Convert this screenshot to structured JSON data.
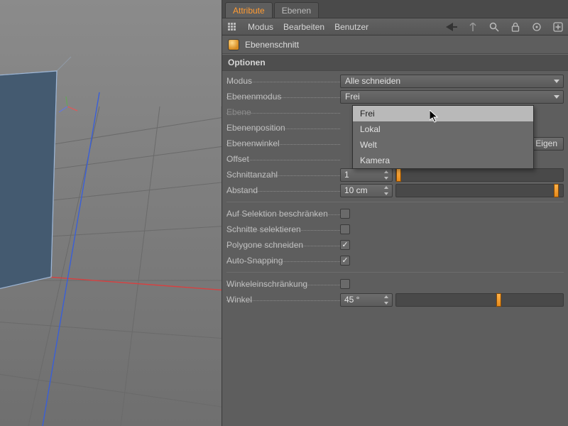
{
  "tabs": {
    "attribute": "Attribute",
    "ebenen": "Ebenen"
  },
  "menu": {
    "modus": "Modus",
    "bearbeiten": "Bearbeiten",
    "benutzer": "Benutzer"
  },
  "object": {
    "name": "Ebenenschnitt"
  },
  "section": {
    "optionen": "Optionen"
  },
  "params": {
    "modus": {
      "label": "Modus",
      "value": "Alle schneiden"
    },
    "ebenenmodus": {
      "label": "Ebenenmodus",
      "value": "Frei"
    },
    "ebene": {
      "label": "Ebene"
    },
    "ebenenposition": {
      "label": "Ebenenposition"
    },
    "ebenenwinkel": {
      "label": "Ebenenwinkel",
      "button": "Eigen"
    },
    "offset": {
      "label": "Offset"
    },
    "schnittanzahl": {
      "label": "Schnittanzahl",
      "value": "1"
    },
    "abstand": {
      "label": "Abstand",
      "value": "10 cm"
    },
    "auf_selektion": {
      "label": "Auf Selektion beschränken",
      "checked": false
    },
    "schnitte_sel": {
      "label": "Schnitte selektieren",
      "checked": false
    },
    "poly_schneiden": {
      "label": "Polygone schneiden",
      "checked": true
    },
    "auto_snap": {
      "label": "Auto-Snapping",
      "checked": true
    },
    "winkel_einschr": {
      "label": "Winkeleinschränkung",
      "checked": false
    },
    "winkel": {
      "label": "Winkel",
      "value": "45 °"
    }
  },
  "dropdown_options": {
    "frei": "Frei",
    "lokal": "Lokal",
    "welt": "Welt",
    "kamera": "Kamera"
  },
  "colors": {
    "accent": "#f49a2d",
    "axis_x": "#d84040",
    "axis_z": "#3a5fd8",
    "cube_edge": "#9fb7d6",
    "cube_fill": "#445a70"
  },
  "chart_data": null
}
